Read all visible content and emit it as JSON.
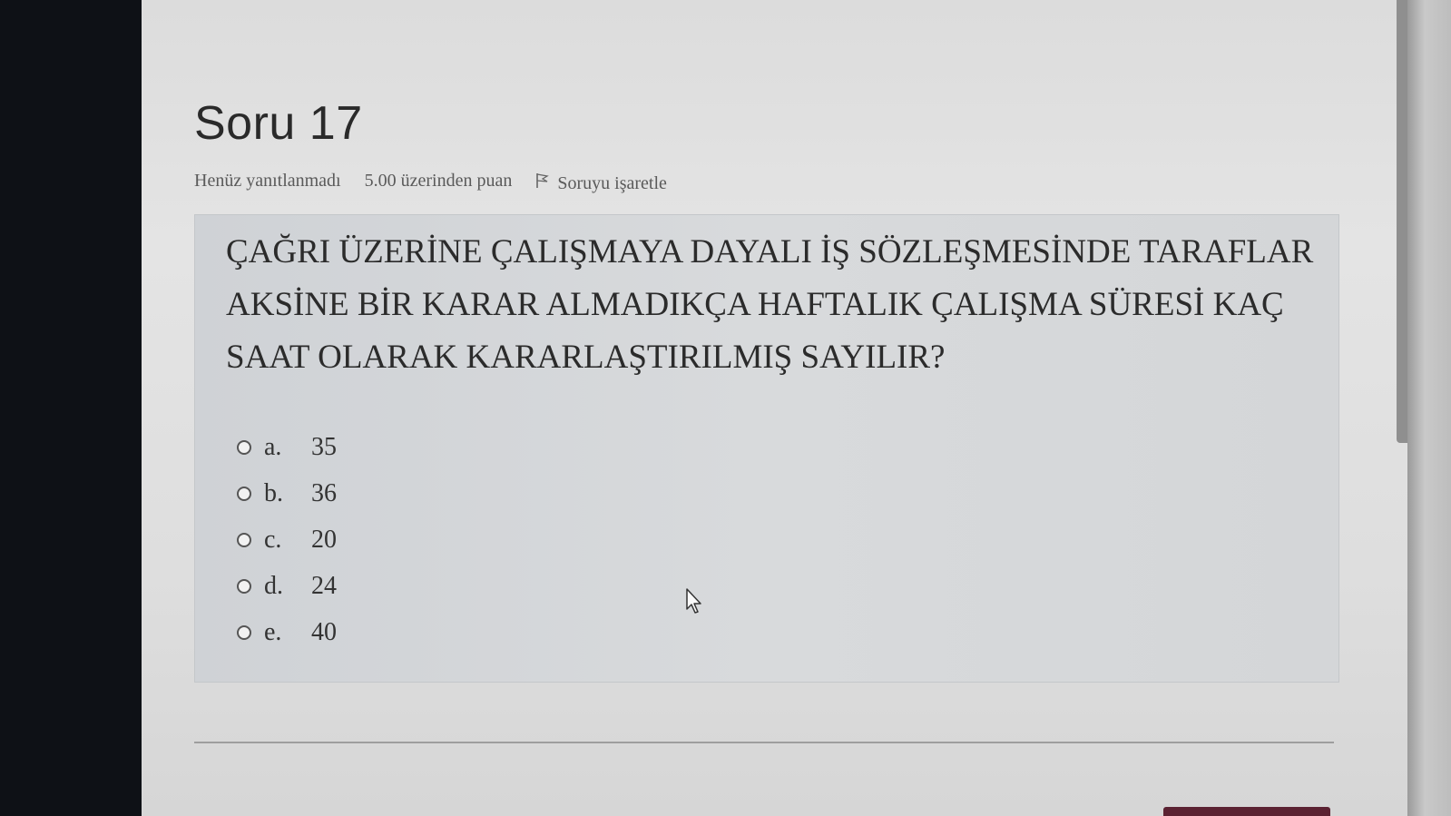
{
  "question": {
    "title": "Soru 17",
    "status": "Henüz yanıtlanmadı",
    "points": "5.00 üzerinden puan",
    "flag_label": "Soruyu işaretle",
    "text": "ÇAĞRI ÜZERİNE ÇALIŞMAYA DAYALI İŞ SÖZLEŞMESİNDE TARAFLAR AKSİNE BİR KARAR ALMADIKÇA HAFTALIK ÇALIŞMA SÜRESİ KAÇ SAAT OLARAK KARARLAŞTIRILMIŞ SAYILIR?"
  },
  "answers": [
    {
      "letter": "a.",
      "value": "35"
    },
    {
      "letter": "b.",
      "value": "36"
    },
    {
      "letter": "c.",
      "value": "20"
    },
    {
      "letter": "d.",
      "value": "24"
    },
    {
      "letter": "e.",
      "value": "40"
    }
  ],
  "icons": {
    "flag": "flag-icon",
    "cursor": "mouse-pointer-icon"
  },
  "colors": {
    "accent": "#5b2232",
    "panel": "#d6d8da",
    "text": "#2b2b2b"
  }
}
